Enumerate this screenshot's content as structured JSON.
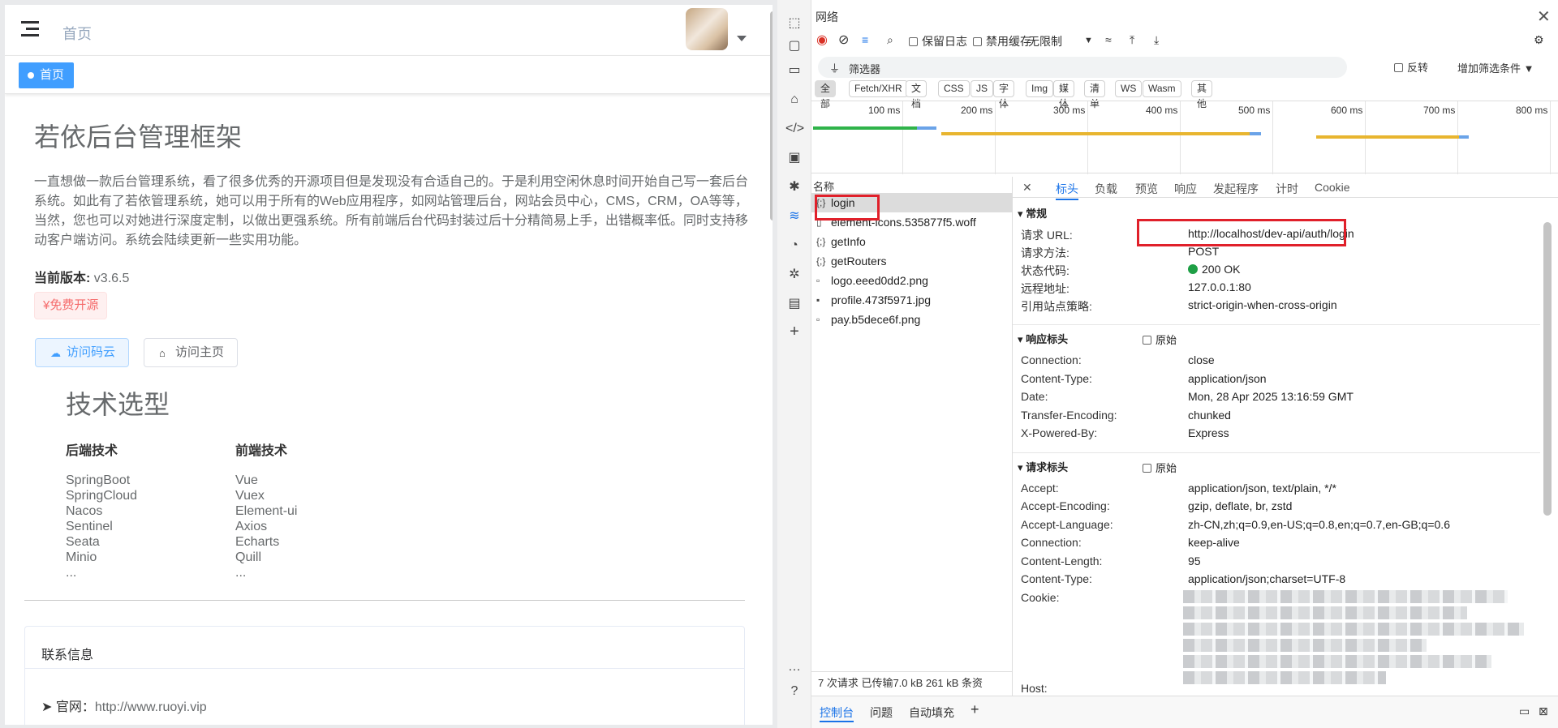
{
  "app": {
    "breadcrumb": "首页",
    "tag_active": "首页",
    "title": "若依后台管理框架",
    "intro": "一直想做一款后台管理系统，看了很多优秀的开源项目但是发现没有合适自己的。于是利用空闲休息时间开始自己写一套后台系统。如此有了若依管理系统，她可以用于所有的Web应用程序，如网站管理后台，网站会员中心，CMS，CRM，OA等等，当然，您也可以对她进行深度定制，以做出更强系统。所有前端后台代码封装过后十分精简易上手，出错概率低。同时支持移动客户端访问。系统会陆续更新一些实用功能。",
    "version_label": "当前版本:",
    "version_value": "v3.6.5",
    "free_tag": "¥免费开源",
    "btn_gitee": "访问码云",
    "btn_home": "访问主页",
    "tech_title": "技术选型",
    "backend_title": "后端技术",
    "frontend_title": "前端技术",
    "backend": [
      "SpringBoot",
      "SpringCloud",
      "Nacos",
      "Sentinel",
      "Seata",
      "Minio",
      "..."
    ],
    "frontend": [
      "Vue",
      "Vuex",
      "Element-ui",
      "Axios",
      "Echarts",
      "Quill",
      "..."
    ],
    "contact_title": "联系信息",
    "site_label": "官网：",
    "site_value": "http://www.ruoyi.vip"
  },
  "devtools": {
    "panel_title": "网络",
    "preserve_log": "保留日志",
    "disable_cache": "禁用缓存",
    "throttle": "无限制",
    "filter_placeholder": "筛选器",
    "invert": "反转",
    "more_filters": "增加筛选条件",
    "chips": [
      "全部",
      "Fetch/XHR",
      "文档",
      "CSS",
      "JS",
      "字体",
      "Img",
      "媒体",
      "清单",
      "WS",
      "Wasm",
      "其他"
    ],
    "ticks": [
      "100 ms",
      "200 ms",
      "300 ms",
      "400 ms",
      "500 ms",
      "600 ms",
      "700 ms",
      "800 ms"
    ],
    "name_header": "名称",
    "requests": [
      "login",
      "element-icons.535877f5.woff",
      "getInfo",
      "getRouters",
      "logo.eeed0dd2.png",
      "profile.473f5971.jpg",
      "pay.b5dece6f.png"
    ],
    "summary": "7 次请求   已传输7.0 kB   261 kB 条资",
    "detail_tabs": [
      "标头",
      "负载",
      "预览",
      "响应",
      "发起程序",
      "计时",
      "Cookie"
    ],
    "general_title": "常规",
    "general": [
      {
        "k": "请求 URL:",
        "v": "http://localhost/dev-api/auth/login"
      },
      {
        "k": "请求方法:",
        "v": "POST"
      },
      {
        "k": "状态代码:",
        "v": "200 OK"
      },
      {
        "k": "远程地址:",
        "v": "127.0.0.1:80"
      },
      {
        "k": "引用站点策略:",
        "v": "strict-origin-when-cross-origin"
      }
    ],
    "resp_title": "响应标头",
    "raw": "原始",
    "resp_headers": [
      {
        "k": "Connection:",
        "v": "close"
      },
      {
        "k": "Content-Type:",
        "v": "application/json"
      },
      {
        "k": "Date:",
        "v": "Mon, 28 Apr 2025 13:16:59 GMT"
      },
      {
        "k": "Transfer-Encoding:",
        "v": "chunked"
      },
      {
        "k": "X-Powered-By:",
        "v": "Express"
      }
    ],
    "req_title": "请求标头",
    "req_headers": [
      {
        "k": "Accept:",
        "v": "application/json, text/plain, */*"
      },
      {
        "k": "Accept-Encoding:",
        "v": "gzip, deflate, br, zstd"
      },
      {
        "k": "Accept-Language:",
        "v": "zh-CN,zh;q=0.9,en-US;q=0.8,en;q=0.7,en-GB;q=0.6"
      },
      {
        "k": "Connection:",
        "v": "keep-alive"
      },
      {
        "k": "Content-Length:",
        "v": "95"
      },
      {
        "k": "Content-Type:",
        "v": "application/json;charset=UTF-8"
      },
      {
        "k": "Cookie:",
        "v": ""
      },
      {
        "k": "Host:",
        "v": ""
      }
    ],
    "drawer_tabs": [
      "控制台",
      "问题",
      "自动填充"
    ]
  }
}
